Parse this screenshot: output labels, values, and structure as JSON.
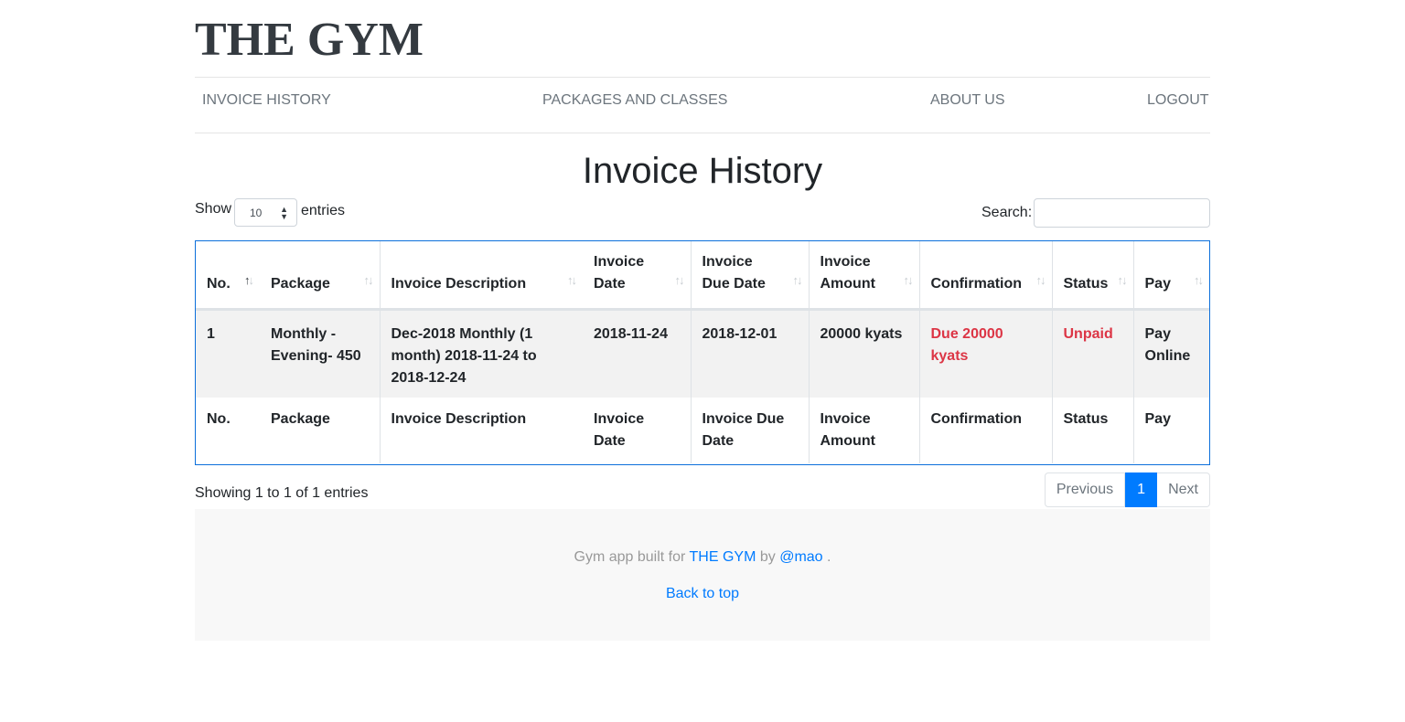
{
  "brand": "THE GYM",
  "nav": {
    "invoice_history": "INVOICE HISTORY",
    "packages": "PACKAGES AND CLASSES",
    "about": "ABOUT US",
    "logout": "LOGOUT"
  },
  "page_title": "Invoice History",
  "controls": {
    "show_label": "Show",
    "page_length": "10",
    "entries_label": "entries",
    "search_label": "Search:",
    "search_value": ""
  },
  "table": {
    "headers": [
      "No.",
      "Package",
      "Invoice Description",
      "Invoice Date",
      "Invoice Due Date",
      "Invoice Amount",
      "Confirmation",
      "Status",
      "Pay"
    ],
    "rows": [
      {
        "no": "1",
        "package": "Monthly -Evening- 450",
        "description": "Dec-2018 Monthly (1 month) 2018-11-24 to 2018-12-24",
        "invoice_date": "2018-11-24",
        "due_date": "2018-12-01",
        "amount": "20000 kyats",
        "confirmation": "Due 20000 kyats",
        "status": "Unpaid",
        "pay": "Pay Online"
      }
    ],
    "status_color": "#dc3545"
  },
  "info": "Showing 1 to 1 of 1 entries",
  "pagination": {
    "previous": "Previous",
    "current": "1",
    "next": "Next"
  },
  "footer": {
    "prefix": "Gym app built for",
    "link1": "THE GYM",
    "by": "by",
    "link2": "@mao",
    "suffix": ".",
    "back_to_top": "Back to top"
  }
}
